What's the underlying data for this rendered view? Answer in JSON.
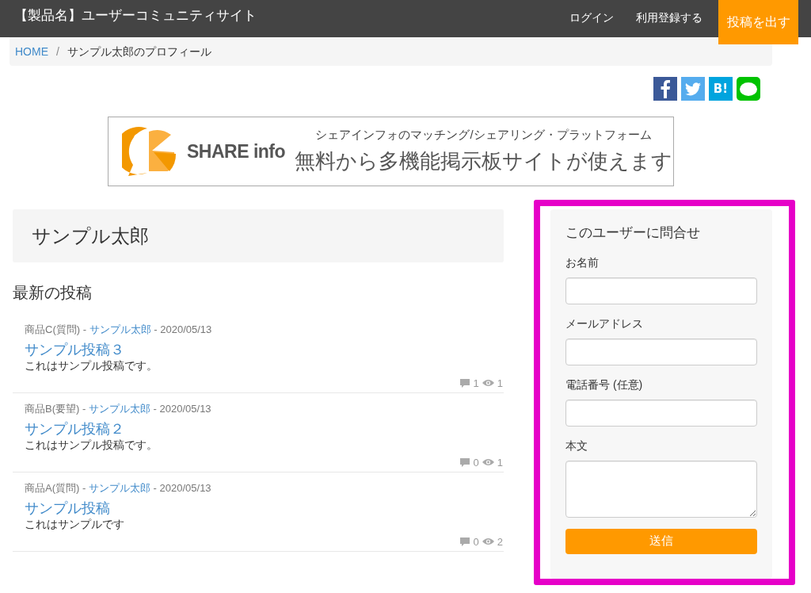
{
  "header": {
    "title": "【製品名】ユーザーコミュニティサイト",
    "nav": [
      {
        "label": "ログイン",
        "kind": "link"
      },
      {
        "label": "利用登録する",
        "kind": "link"
      },
      {
        "label": "投稿を出す",
        "kind": "primary"
      }
    ]
  },
  "breadcrumb_separator": "/",
  "breadcrumb": [
    {
      "label": "HOME",
      "kind": "link"
    },
    {
      "label": "サンプル太郎のプロフィール",
      "kind": "current"
    }
  ],
  "share_buttons": [
    {
      "kind": "facebook",
      "color": "#3b5998"
    },
    {
      "kind": "twitter",
      "color": "#55acee"
    },
    {
      "kind": "hatena",
      "color": "#00a4de",
      "label": "B!"
    },
    {
      "kind": "line",
      "color": "#00c300"
    }
  ],
  "banner": {
    "brand": "SHARE info",
    "tagline": "シェアインフォのマッチング/シェアリング・プラットフォーム",
    "headline": "無料から多機能掲示板サイトが使えます"
  },
  "profile": {
    "name": "サンプル太郎"
  },
  "posts_section": {
    "heading": "最新の投稿",
    "meta_separator": "-",
    "posts": [
      {
        "category": "商品C(質問)",
        "author": "サンプル太郎",
        "date": "2020/05/13",
        "title": "サンプル投稿３",
        "body": "これはサンプル投稿です。",
        "comments": "1",
        "views": "1"
      },
      {
        "category": "商品B(要望)",
        "author": "サンプル太郎",
        "date": "2020/05/13",
        "title": "サンプル投稿２",
        "body": "これはサンプル投稿です。",
        "comments": "0",
        "views": "1"
      },
      {
        "category": "商品A(質問)",
        "author": "サンプル太郎",
        "date": "2020/05/13",
        "title": "サンプル投稿",
        "body": "これはサンプルです",
        "comments": "0",
        "views": "2"
      }
    ]
  },
  "contact_form": {
    "highlighted": true,
    "title": "このユーザーに問合せ",
    "fields": [
      {
        "label": "お名前",
        "kind": "text"
      },
      {
        "label": "メールアドレス",
        "kind": "text"
      },
      {
        "label": "電話番号 (任意)",
        "kind": "text"
      },
      {
        "label": "本文",
        "kind": "textarea"
      }
    ],
    "submit": "送信"
  }
}
